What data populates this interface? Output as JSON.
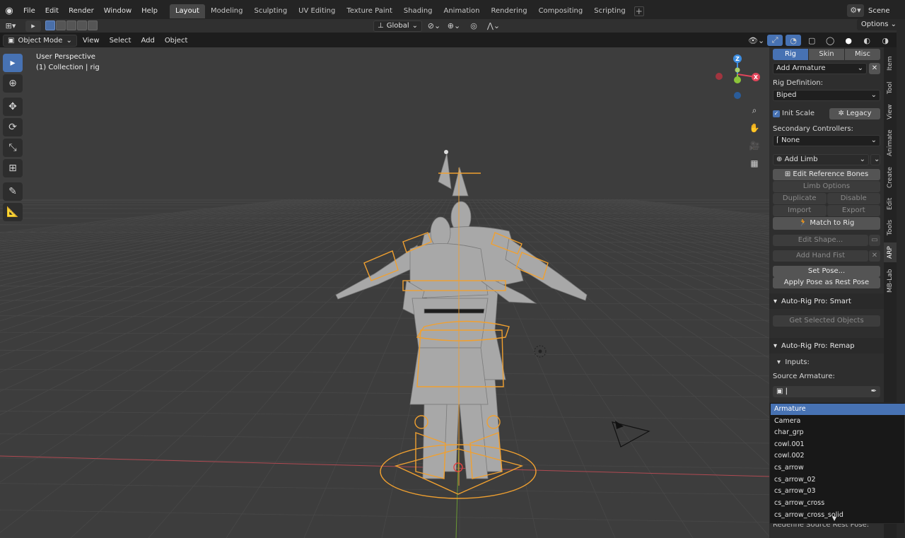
{
  "topbar": {
    "menus": [
      "File",
      "Edit",
      "Render",
      "Window",
      "Help"
    ],
    "workspaces": [
      "Layout",
      "Modeling",
      "Sculpting",
      "UV Editing",
      "Texture Paint",
      "Shading",
      "Animation",
      "Rendering",
      "Compositing",
      "Scripting"
    ],
    "active_workspace": "Layout",
    "add_tab": "+",
    "scene": "Scene"
  },
  "header": {
    "orientation": "Global",
    "options": "Options"
  },
  "header2": {
    "mode": "Object Mode",
    "menus": [
      "View",
      "Select",
      "Add",
      "Object"
    ]
  },
  "viewport": {
    "perspective": "User Perspective",
    "collection": "(1) Collection | rig",
    "gizmo_axes": {
      "x": "X",
      "y": "Y",
      "z": "Z"
    }
  },
  "sidebar": {
    "tabs": [
      "Rig",
      "Skin",
      "Misc"
    ],
    "active_tab": "Rig",
    "add_armature": "Add Armature",
    "rig_definition_label": "Rig Definition:",
    "rig_definition_value": "Biped",
    "init_scale": "Init Scale",
    "legacy": "Legacy",
    "secondary_controllers_label": "Secondary Controllers:",
    "secondary_controllers_value": "None",
    "add_limb": "Add Limb",
    "edit_reference_bones": "Edit Reference Bones",
    "limb_options": "Limb Options",
    "duplicate": "Duplicate",
    "disable": "Disable",
    "import": "Import",
    "export": "Export",
    "match_to_rig": "Match to Rig",
    "edit_shape": "Edit Shape...",
    "add_hand_fist": "Add Hand Fist",
    "set_pose": "Set Pose...",
    "apply_pose": "Apply Pose as Rest Pose",
    "smart_panel": "Auto-Rig Pro: Smart",
    "get_selected_objects": "Get Selected Objects",
    "remap_panel": "Auto-Rig Pro: Remap",
    "inputs": "Inputs:",
    "source_armature_label": "Source Armature:",
    "redefine_source": "Redefine Source Rest Pose:"
  },
  "vertical_tabs": [
    "Item",
    "Tool",
    "View",
    "Animate",
    "Create",
    "Edit",
    "Tools",
    "ARP",
    "MB-Lab"
  ],
  "active_vertical_tab": "ARP",
  "dropdown": {
    "items": [
      "Armature",
      "Camera",
      "char_grp",
      "cowl.001",
      "cowl.002",
      "cs_arrow",
      "cs_arrow_02",
      "cs_arrow_03",
      "cs_arrow_cross",
      "cs_arrow_cross_solid"
    ],
    "highlighted": "Armature"
  },
  "colors": {
    "accent": "#4772b3",
    "selection_orange": "#f0a030",
    "axis_x": "#e0455a",
    "axis_y": "#8cc43a",
    "axis_z": "#3d8de0"
  },
  "icons": {
    "blender": "blender-logo-icon",
    "select_tool": "cursor-icon",
    "cursor_tool": "3d-cursor-icon",
    "move_tool": "move-icon",
    "rotate_tool": "rotate-icon",
    "scale_tool": "scale-icon",
    "transform_tool": "transform-icon",
    "annotate_tool": "annotate-icon",
    "measure_tool": "measure-icon"
  }
}
